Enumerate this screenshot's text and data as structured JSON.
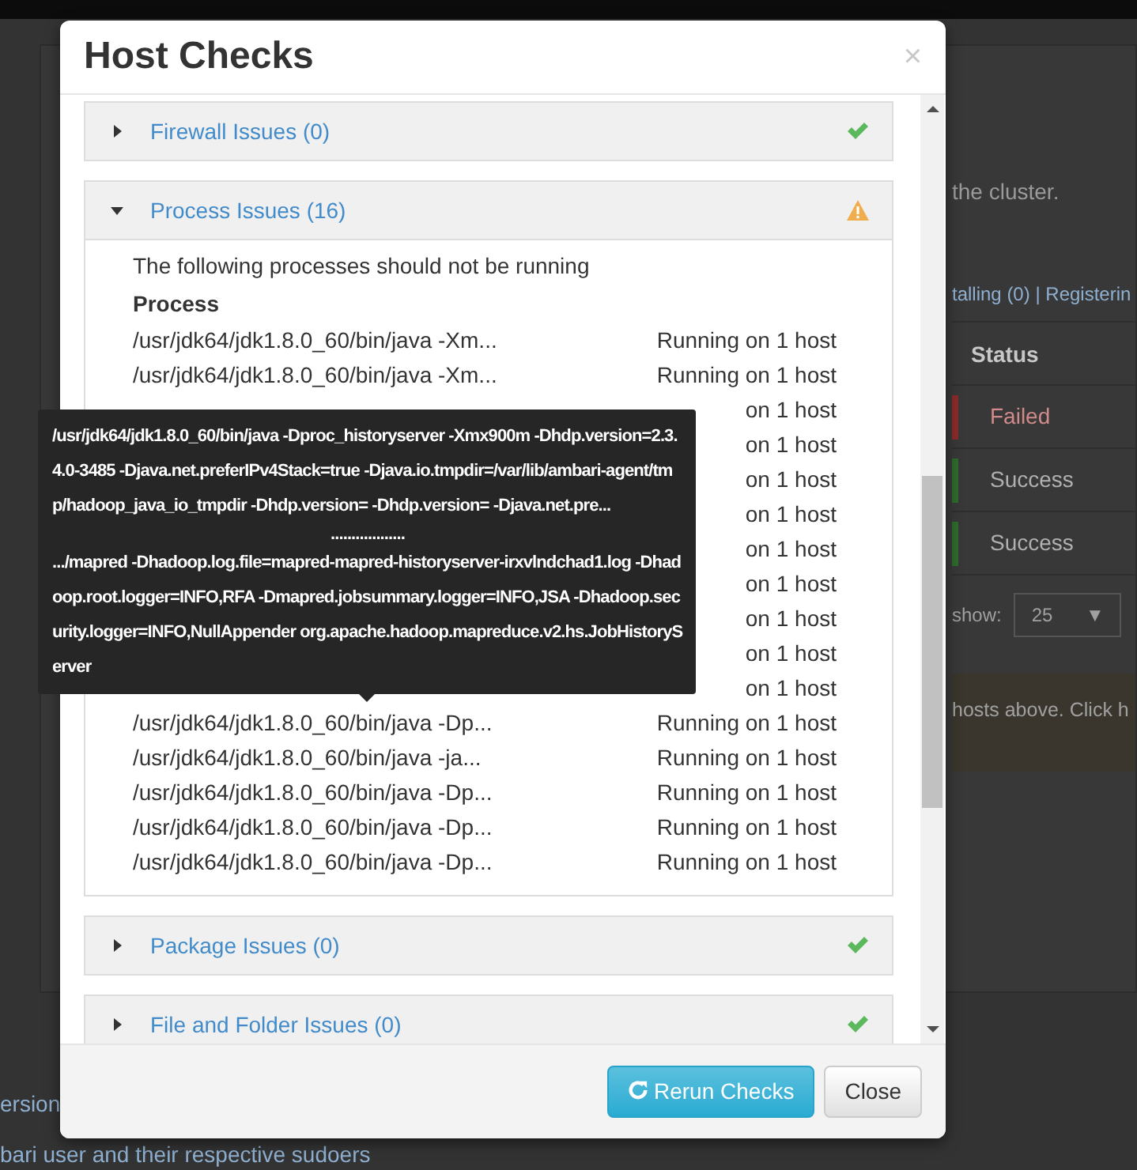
{
  "background": {
    "notice": "the cluster.",
    "filter_links": [
      {
        "label": "talling (0)"
      },
      {
        "label": "Registerin"
      }
    ],
    "filter_separator": "|",
    "table": {
      "columns": [
        "Status"
      ],
      "rows": [
        {
          "status": "Failed",
          "kind": "failed"
        },
        {
          "status": "Success",
          "kind": "success"
        },
        {
          "status": "Success",
          "kind": "success"
        }
      ]
    },
    "pager": {
      "label": "show:",
      "value": "25",
      "caret": "▼"
    },
    "hint": "hosts above.",
    "hint_link": "Click h",
    "footer_lines": [
      "ersion",
      "bari user and their respective sudoers"
    ]
  },
  "modal": {
    "title": "Host Checks",
    "close": "×",
    "sections": [
      {
        "title": "Firewall Issues (0)",
        "expanded": false,
        "kind": "ok"
      },
      {
        "title": "Process Issues (16)",
        "expanded": true,
        "kind": "warning",
        "intro": "The following processes should not be running",
        "column": "Process",
        "rows": [
          {
            "process": "/usr/jdk64/jdk1.8.0_60/bin/java -Xm...",
            "prefix": "Running on",
            "link": "1 host"
          },
          {
            "process": "/usr/jdk64/jdk1.8.0_60/bin/java -Xm...",
            "prefix": "Running on",
            "link": "1 host"
          },
          {
            "prefix": "on",
            "link": "1 host"
          },
          {
            "prefix": "on",
            "link": "1 host"
          },
          {
            "prefix": "on",
            "link": "1 host"
          },
          {
            "prefix": "on",
            "link": "1 host"
          },
          {
            "prefix": "on",
            "link": "1 host"
          },
          {
            "prefix": "on",
            "link": "1 host"
          },
          {
            "prefix": "on",
            "link": "1 host"
          },
          {
            "prefix": "on",
            "link": "1 host"
          },
          {
            "prefix": "on",
            "link": "1 host"
          },
          {
            "process": "/usr/jdk64/jdk1.8.0_60/bin/java -Dp...",
            "prefix": "Running on",
            "link": "1 host"
          },
          {
            "process": "/usr/jdk64/jdk1.8.0_60/bin/java -ja...",
            "prefix": "Running on",
            "link": "1 host"
          },
          {
            "process": "/usr/jdk64/jdk1.8.0_60/bin/java -Dp...",
            "prefix": "Running on",
            "link": "1 host"
          },
          {
            "process": "/usr/jdk64/jdk1.8.0_60/bin/java -Dp...",
            "prefix": "Running on",
            "link": "1 host"
          },
          {
            "process": "/usr/jdk64/jdk1.8.0_60/bin/java -Dp...",
            "prefix": "Running on",
            "link": "1 host"
          }
        ]
      },
      {
        "title": "Package Issues (0)",
        "expanded": false,
        "kind": "ok"
      },
      {
        "title": "File and Folder Issues (0)",
        "expanded": false,
        "kind": "ok"
      }
    ],
    "buttons": [
      {
        "label": "Rerun Checks",
        "kind": "primary"
      },
      {
        "label": "Close",
        "kind": "default"
      }
    ]
  },
  "tooltip": {
    "head": "/usr/jdk64/jdk1.8.0_60/bin/java -Dproc_historyserver -Xmx900m -Dhdp.version=2.3.4.0-3485 -Djava.net.preferIPv4Stack=true -Djava.io.tmpdir=/var/lib/ambari-agent/tmp/hadoop_java_io_tmpdir -Dhdp.version= -Dhdp.version= -Djava.net.pre...",
    "separator": "..................",
    "tail": ".../mapred -Dhadoop.log.file=mapred-mapred-historyserver-irxvlndchad1.log -Dhadoop.root.logger=INFO,RFA -Dmapred.jobsummary.logger=INFO,JSA -Dhadoop.security.logger=INFO,NullAppender org.apache.hadoop.mapreduce.v2.hs.JobHistoryServer"
  }
}
